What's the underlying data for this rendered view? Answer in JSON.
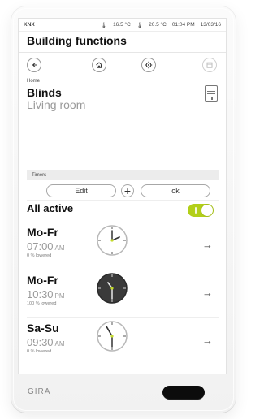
{
  "device": {
    "brand": "GIRA"
  },
  "status_bar": {
    "system": "KNX",
    "temp1": "16.5 °C",
    "temp2": "20.5 °C",
    "time": "01:04 PM",
    "date": "13/03/16"
  },
  "app": {
    "title": "Building functions"
  },
  "nav": {
    "icons": [
      "back-icon",
      "home-icon",
      "settings-icon",
      "calendar-icon"
    ]
  },
  "header": {
    "breadcrumb": "Home",
    "title": "Blinds",
    "subtitle": "Living room"
  },
  "timers": {
    "section_label": "Timers",
    "edit_label": "Edit",
    "add_label": "+",
    "ok_label": "ok",
    "all_active_label": "All active",
    "all_active_enabled": true,
    "items": [
      {
        "days": "Mo-Fr",
        "time": "07:00",
        "ampm": "AM",
        "note": "0 % lowered",
        "clock_style": "light"
      },
      {
        "days": "Mo-Fr",
        "time": "10:30",
        "ampm": "PM",
        "note": "100 % lowered",
        "clock_style": "dark"
      },
      {
        "days": "Sa-Su",
        "time": "09:30",
        "ampm": "AM",
        "note": "0 % lowered",
        "clock_style": "light"
      }
    ]
  },
  "colors": {
    "toggle_on": "#b2cf19",
    "screen_bg": "#ffffff"
  }
}
